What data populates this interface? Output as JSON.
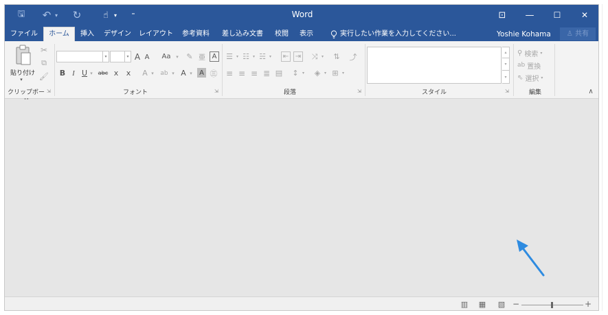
{
  "window": {
    "title": "Word",
    "controls": {
      "ribbon_options": "⊡",
      "minimize": "—",
      "maximize": "☐",
      "close": "✕"
    }
  },
  "qat": {
    "save": "🖫",
    "undo": "↶",
    "undo_dropdown": "▾",
    "redo": "↻",
    "touch_mode": "☝",
    "touch_dropdown": "▾",
    "customize": "⁼"
  },
  "tabs": [
    {
      "id": "file",
      "label": "ファイル"
    },
    {
      "id": "home",
      "label": "ホーム",
      "active": true
    },
    {
      "id": "insert",
      "label": "挿入"
    },
    {
      "id": "design",
      "label": "デザイン"
    },
    {
      "id": "layout",
      "label": "レイアウト"
    },
    {
      "id": "references",
      "label": "参考資料"
    },
    {
      "id": "mailings",
      "label": "差し込み文書"
    },
    {
      "id": "review",
      "label": "校閲"
    },
    {
      "id": "view",
      "label": "表示"
    }
  ],
  "tell_me": {
    "icon": "lightbulb-icon",
    "placeholder": "実行したい作業を入力してください..."
  },
  "user": {
    "name": "Yoshie Kohama",
    "share_label": "共有"
  },
  "ribbon": {
    "clipboard": {
      "label": "クリップボード",
      "paste_label": "貼り付け",
      "paste_arrow": "▾"
    },
    "font": {
      "label": "フォント",
      "font_name": "",
      "font_size": "",
      "grow": "A",
      "shrink": "A",
      "change_case": "Aa",
      "bold": "B",
      "italic": "I",
      "underline": "U",
      "strikethrough": "abc",
      "subscript": "x",
      "superscript": "x",
      "text_effects": "A",
      "highlight": "ab",
      "font_color": "A",
      "char_shading": "A",
      "enclose": "㊂"
    },
    "paragraph": {
      "label": "段落"
    },
    "styles": {
      "label": "スタイル"
    },
    "editing": {
      "label": "編集",
      "find": "検索",
      "replace": "置換",
      "select": "選択"
    },
    "collapse": "∧"
  },
  "statusbar": {
    "zoom_minus": "−",
    "zoom_plus": "+"
  },
  "colors": {
    "title_bar": "#2b579a",
    "ribbon_bg": "#f3f3f3",
    "document_bg": "#e6e6e6",
    "annotation_arrow": "#2e8be0"
  }
}
